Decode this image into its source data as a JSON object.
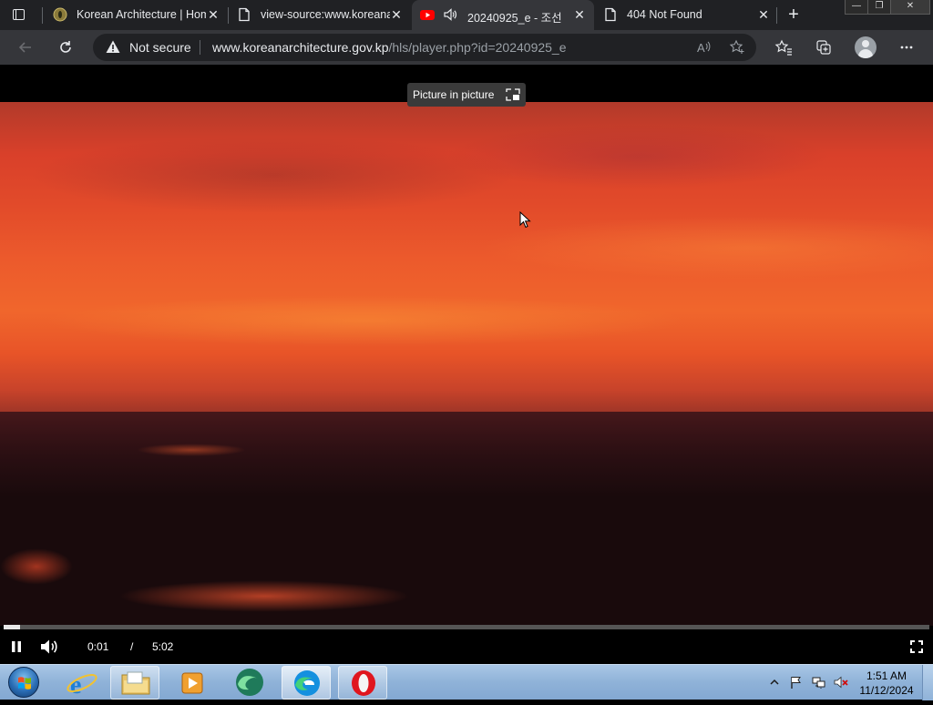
{
  "browser": {
    "tabs": [
      {
        "title": "Korean Architecture | Hom",
        "favicon": "emblem-icon"
      },
      {
        "title": "view-source:www.koreana",
        "favicon": "page-icon"
      },
      {
        "title": "20240925_e - 조선",
        "favicon": "youtube-icon",
        "audio": "speaker-icon",
        "active": true
      },
      {
        "title": "404 Not Found",
        "favicon": "page-icon"
      }
    ],
    "close_glyph": "✕",
    "new_tab_glyph": "+",
    "window_controls": {
      "minimize": "—",
      "restore": "❐",
      "close": "✕"
    }
  },
  "toolbar": {
    "security_label": "Not secure",
    "url_host": "www.koreanarchitecture.gov.kp",
    "url_path": "/hls/player.php?id=20240925_e"
  },
  "player": {
    "pip_label": "Picture in picture",
    "current_time": "0:01",
    "time_separator": "/",
    "duration": "5:02",
    "progress_fraction": 0.018
  },
  "taskbar": {
    "clock_time": "1:51 AM",
    "clock_date": "11/12/2024"
  },
  "colors": {
    "tabstrip_bg": "#202124",
    "toolbar_bg": "#35363a",
    "text": "#e8eaed"
  }
}
